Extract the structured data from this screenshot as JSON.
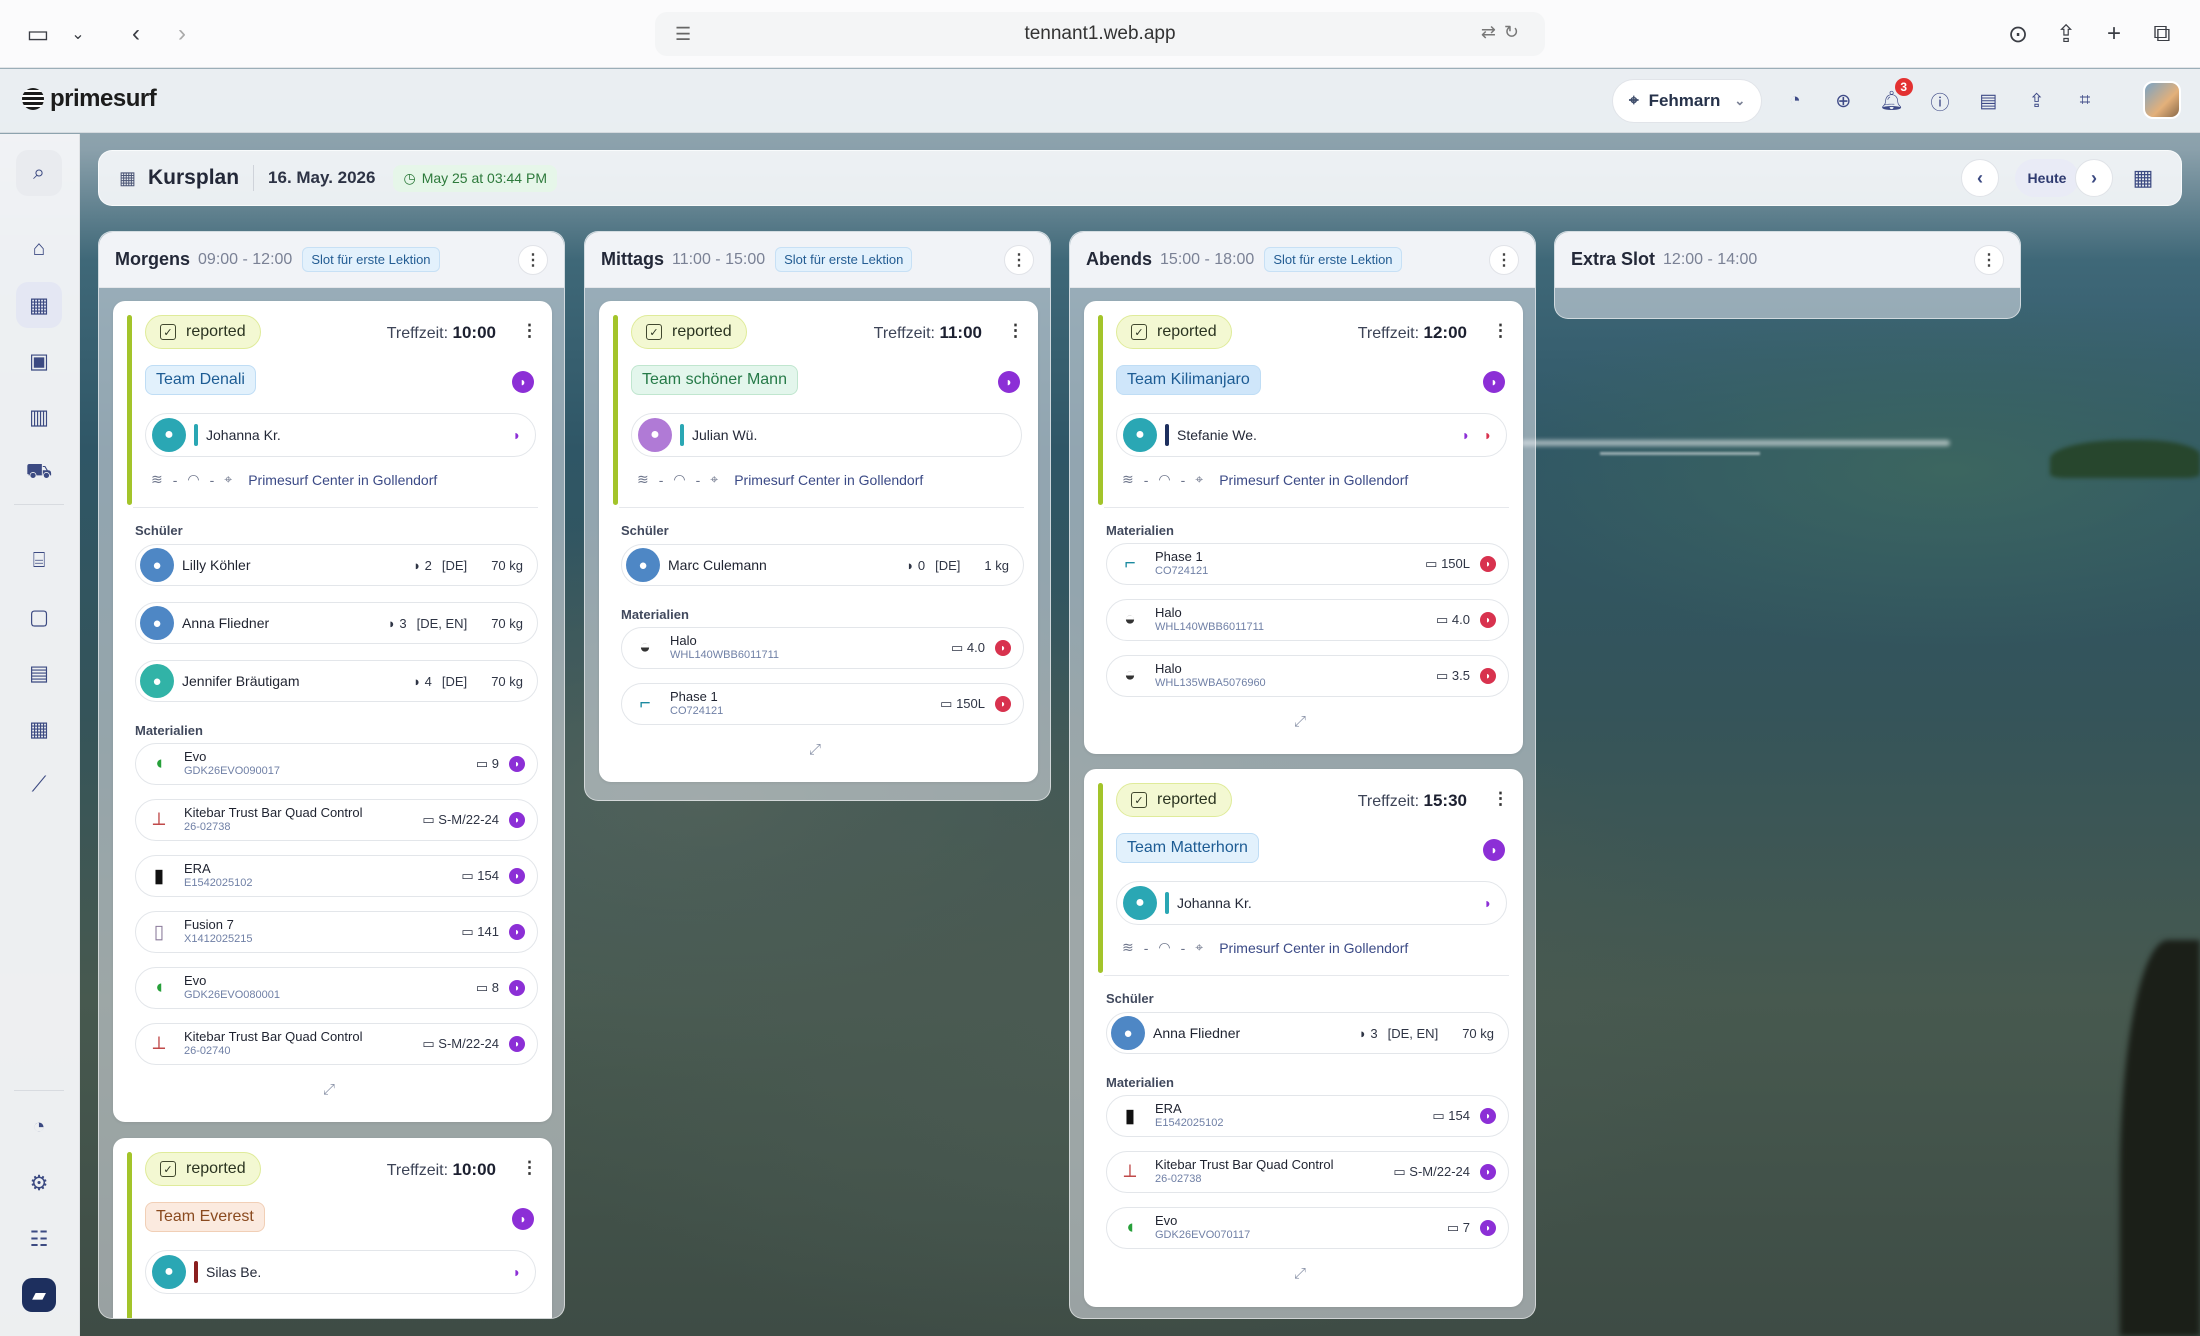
{
  "browser": {
    "url": "tennant1.web.app"
  },
  "brand": {
    "name": "primesurf"
  },
  "header": {
    "location": "Fehmarn",
    "notification_count": "3"
  },
  "topbar": {
    "title": "Kursplan",
    "date": "16. May. 2026",
    "sync": "May 25 at 03:44 PM",
    "today": "Heute"
  },
  "columns": [
    {
      "name": "Morgens",
      "time": "09:00 - 12:00",
      "slot": "Slot für erste Lektion"
    },
    {
      "name": "Mittags",
      "time": "11:00 - 15:00",
      "slot": "Slot für erste Lektion"
    },
    {
      "name": "Abends",
      "time": "15:00 - 18:00",
      "slot": "Slot für erste Lektion"
    },
    {
      "name": "Extra Slot",
      "time": "12:00 - 14:00"
    }
  ],
  "labels": {
    "status": "reported",
    "treffzeit": "Treffzeit:",
    "students": "Schüler",
    "materials": "Materialien",
    "dash": "-",
    "location": "Primesurf Center in Gollendorf"
  },
  "cards": {
    "denali": {
      "time": "10:00",
      "team": "Team Denali",
      "instructor": "Johanna Kr.",
      "students": [
        {
          "name": "Lilly Köhler",
          "level": "2",
          "lang": "[DE]",
          "weight": "70 kg"
        },
        {
          "name": "Anna Fliedner",
          "level": "3",
          "lang": "[DE, EN]",
          "weight": "70 kg"
        },
        {
          "name": "Jennifer Bräutigam",
          "level": "4",
          "lang": "[DE]",
          "weight": "70 kg"
        }
      ],
      "materials": [
        {
          "name": "Evo",
          "code": "GDK26EVO090017",
          "size": "9"
        },
        {
          "name": "Kitebar Trust Bar Quad Control",
          "code": "26-02738",
          "size": "S-M/22-24"
        },
        {
          "name": "ERA",
          "code": "E1542025102",
          "size": "154"
        },
        {
          "name": "Fusion 7",
          "code": "X1412025215",
          "size": "141"
        },
        {
          "name": "Evo",
          "code": "GDK26EVO080001",
          "size": "8"
        },
        {
          "name": "Kitebar Trust Bar Quad Control",
          "code": "26-02740",
          "size": "S-M/22-24"
        }
      ]
    },
    "everest": {
      "time": "10:00",
      "team": "Team Everest",
      "instructor": "Silas Be."
    },
    "schoener": {
      "time": "11:00",
      "team": "Team schöner Mann",
      "instructor": "Julian Wü.",
      "students": [
        {
          "name": "Marc Culemann",
          "level": "0",
          "lang": "[DE]",
          "weight": "1 kg"
        }
      ],
      "materials": [
        {
          "name": "Halo",
          "code": "WHL140WBB6011711",
          "size": "4.0"
        },
        {
          "name": "Phase 1",
          "code": "CO724121",
          "size": "150L"
        }
      ]
    },
    "kilimanjaro": {
      "time": "12:00",
      "team": "Team Kilimanjaro",
      "instructor": "Stefanie We.",
      "materials": [
        {
          "name": "Phase 1",
          "code": "CO724121",
          "size": "150L"
        },
        {
          "name": "Halo",
          "code": "WHL140WBB6011711",
          "size": "4.0"
        },
        {
          "name": "Halo",
          "code": "WHL135WBA5076960",
          "size": "3.5"
        }
      ]
    },
    "matterhorn": {
      "time": "15:30",
      "team": "Team Matterhorn",
      "instructor": "Johanna Kr.",
      "students": [
        {
          "name": "Anna Fliedner",
          "level": "3",
          "lang": "[DE, EN]",
          "weight": "70 kg"
        }
      ],
      "materials": [
        {
          "name": "ERA",
          "code": "E1542025102",
          "size": "154"
        },
        {
          "name": "Kitebar Trust Bar Quad Control",
          "code": "26-02738",
          "size": "S-M/22-24"
        },
        {
          "name": "Evo",
          "code": "GDK26EVO070117",
          "size": "7"
        }
      ]
    }
  },
  "colors": {
    "accent": "#3c4a82",
    "status_bar": "#a3c42a",
    "kite_purple": "#8c2fd6",
    "kite_red": "#d8324e"
  }
}
